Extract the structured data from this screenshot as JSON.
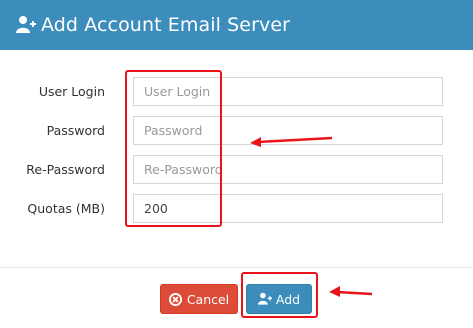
{
  "dialog": {
    "title": "Add Account Email Server",
    "header_icon": "user-plus-icon"
  },
  "form": {
    "fields": [
      {
        "label": "User Login",
        "value": "",
        "placeholder": "User Login",
        "type": "text"
      },
      {
        "label": "Password",
        "value": "",
        "placeholder": "Password",
        "type": "password"
      },
      {
        "label": "Re-Password",
        "value": "",
        "placeholder": "Re-Password",
        "type": "password"
      },
      {
        "label": "Quotas (MB)",
        "value": "200",
        "placeholder": "",
        "type": "text"
      }
    ]
  },
  "footer": {
    "cancel_label": "Cancel",
    "cancel_icon": "times-circle-icon",
    "add_label": "Add",
    "add_icon": "user-plus-icon"
  },
  "colors": {
    "header_bg": "#3c8dbc",
    "cancel_bg": "#dd4b39",
    "add_bg": "#3c8dbc",
    "annotation": "#e8141a"
  }
}
